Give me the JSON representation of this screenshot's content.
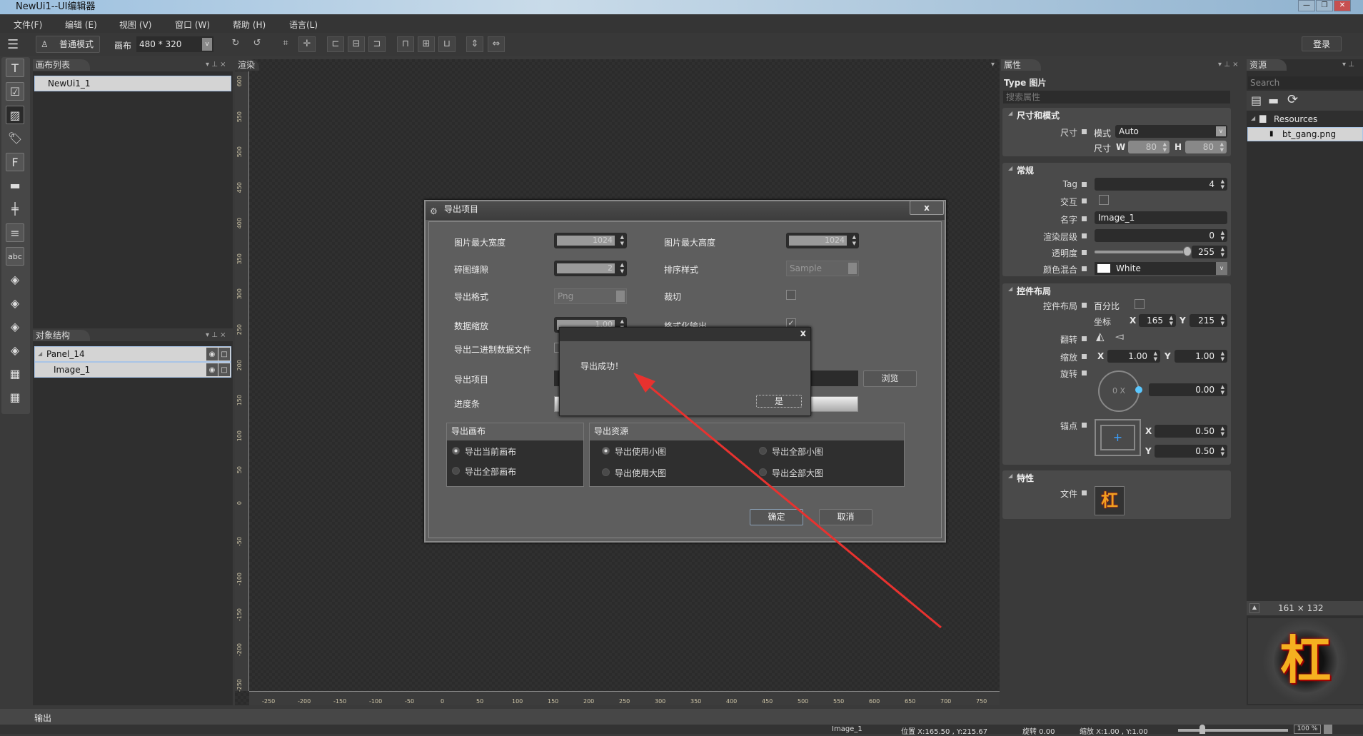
{
  "window": {
    "title": "NewUi1--UI编辑器",
    "minimize": "—",
    "restore": "❐",
    "close": "✕"
  },
  "menu": [
    "文件(F)",
    "编辑 (E)",
    "视图 (V)",
    "窗口 (W)",
    "帮助 (H)",
    "语言(L)"
  ],
  "toolbar": {
    "mode_label": "普通模式",
    "canvas_label": "画布",
    "canvas_size": "480 * 320",
    "login": "登录"
  },
  "canvas_list": {
    "title": "画布列表",
    "items": [
      "NewUi1_1"
    ]
  },
  "object_tree": {
    "title": "对象结构",
    "items": [
      {
        "label": "Panel_14"
      },
      {
        "label": "Image_1"
      }
    ]
  },
  "render": {
    "title": "渲染",
    "ruler_h": [
      "-250",
      "-200",
      "-150",
      "-100",
      "-50",
      "0",
      "50",
      "100",
      "150",
      "200",
      "250",
      "300",
      "350",
      "400",
      "450",
      "500",
      "550",
      "600",
      "650",
      "700",
      "750"
    ],
    "ruler_v": [
      "600",
      "550",
      "500",
      "450",
      "400",
      "350",
      "300",
      "250",
      "200",
      "150",
      "100",
      "50",
      "0",
      "-50",
      "-100",
      "-150",
      "-200",
      "-250"
    ]
  },
  "export_dialog": {
    "title": "导出项目",
    "max_width_label": "图片最大宽度",
    "max_width": "1024",
    "max_height_label": "图片最大高度",
    "max_height": "1024",
    "gap_label": "碎图缝隙",
    "gap": "2",
    "sort_label": "排序样式",
    "sort": "Sample",
    "format_label": "导出格式",
    "format": "Png",
    "crop_label": "裁切",
    "crop_checked": false,
    "scale_label": "数据缩放",
    "scale": "1.00",
    "format_output_label": "格式化输出",
    "format_output_checked": true,
    "binary_label": "导出二进制数据文件",
    "project_label": "导出项目",
    "browse": "浏览",
    "progress_label": "进度条",
    "progress": 1.0,
    "canvas_group": {
      "title": "导出画布",
      "options": [
        "导出当前画布",
        "导出全部画布"
      ],
      "selected": 0
    },
    "resource_group": {
      "title": "导出资源",
      "options": [
        "导出使用小图",
        "导出全部小图",
        "导出使用大图",
        "导出全部大图"
      ],
      "selected": 0
    },
    "ok": "确定",
    "cancel": "取消"
  },
  "message_box": {
    "text": "导出成功！",
    "yes": "是",
    "close": "x"
  },
  "annotation": {
    "color": "#e8322f"
  },
  "properties": {
    "title": "属性",
    "type_label": "Type",
    "type_value": "图片",
    "search_placeholder": "搜索属性",
    "size_section": "尺寸和模式",
    "size_label": "尺寸",
    "mode_label": "模式",
    "mode": "Auto",
    "size2_label": "尺寸",
    "w_label": "W",
    "w": "80",
    "h_label": "H",
    "h": "80",
    "general_section": "常规",
    "tag_label": "Tag",
    "tag": "4",
    "interact_label": "交互",
    "name_label": "名字",
    "name": "Image_1",
    "layer_label": "渲染层级",
    "layer": "0",
    "alpha_label": "透明度",
    "alpha": "255",
    "alpha_fraction": 1.0,
    "blend_label": "颜色混合",
    "blend": "White",
    "layout_section": "控件布局",
    "layout_label": "控件布局",
    "percent_label": "百分比",
    "pos_label": "坐标",
    "x_label": "X",
    "y_label": "Y",
    "pos_x": "165",
    "pos_y": "215",
    "flip_label": "翻转",
    "scale_label": "缩放",
    "scale_x": "1.00",
    "scale_y": "1.00",
    "rotate_label": "旋转",
    "rotate_dial": "0 X",
    "rotate": "0.00",
    "anchor_label": "锚点",
    "anchor_x": "0.50",
    "anchor_y": "0.50",
    "feature_section": "特性",
    "file_label": "文件"
  },
  "resources": {
    "title": "资源",
    "search_placeholder": "Search",
    "folder": "Resources",
    "file": "bt_gang.png",
    "preview_size": "161 × 132",
    "preview_glyph": "杠"
  },
  "output": {
    "title": "输出"
  },
  "status": {
    "object": "Image_1",
    "position": "位置 X:165.50 , Y:215.67",
    "rotate": "旋转 0.00",
    "scale": "缩放 X:1.00 , Y:1.00",
    "zoom": "100 %"
  }
}
